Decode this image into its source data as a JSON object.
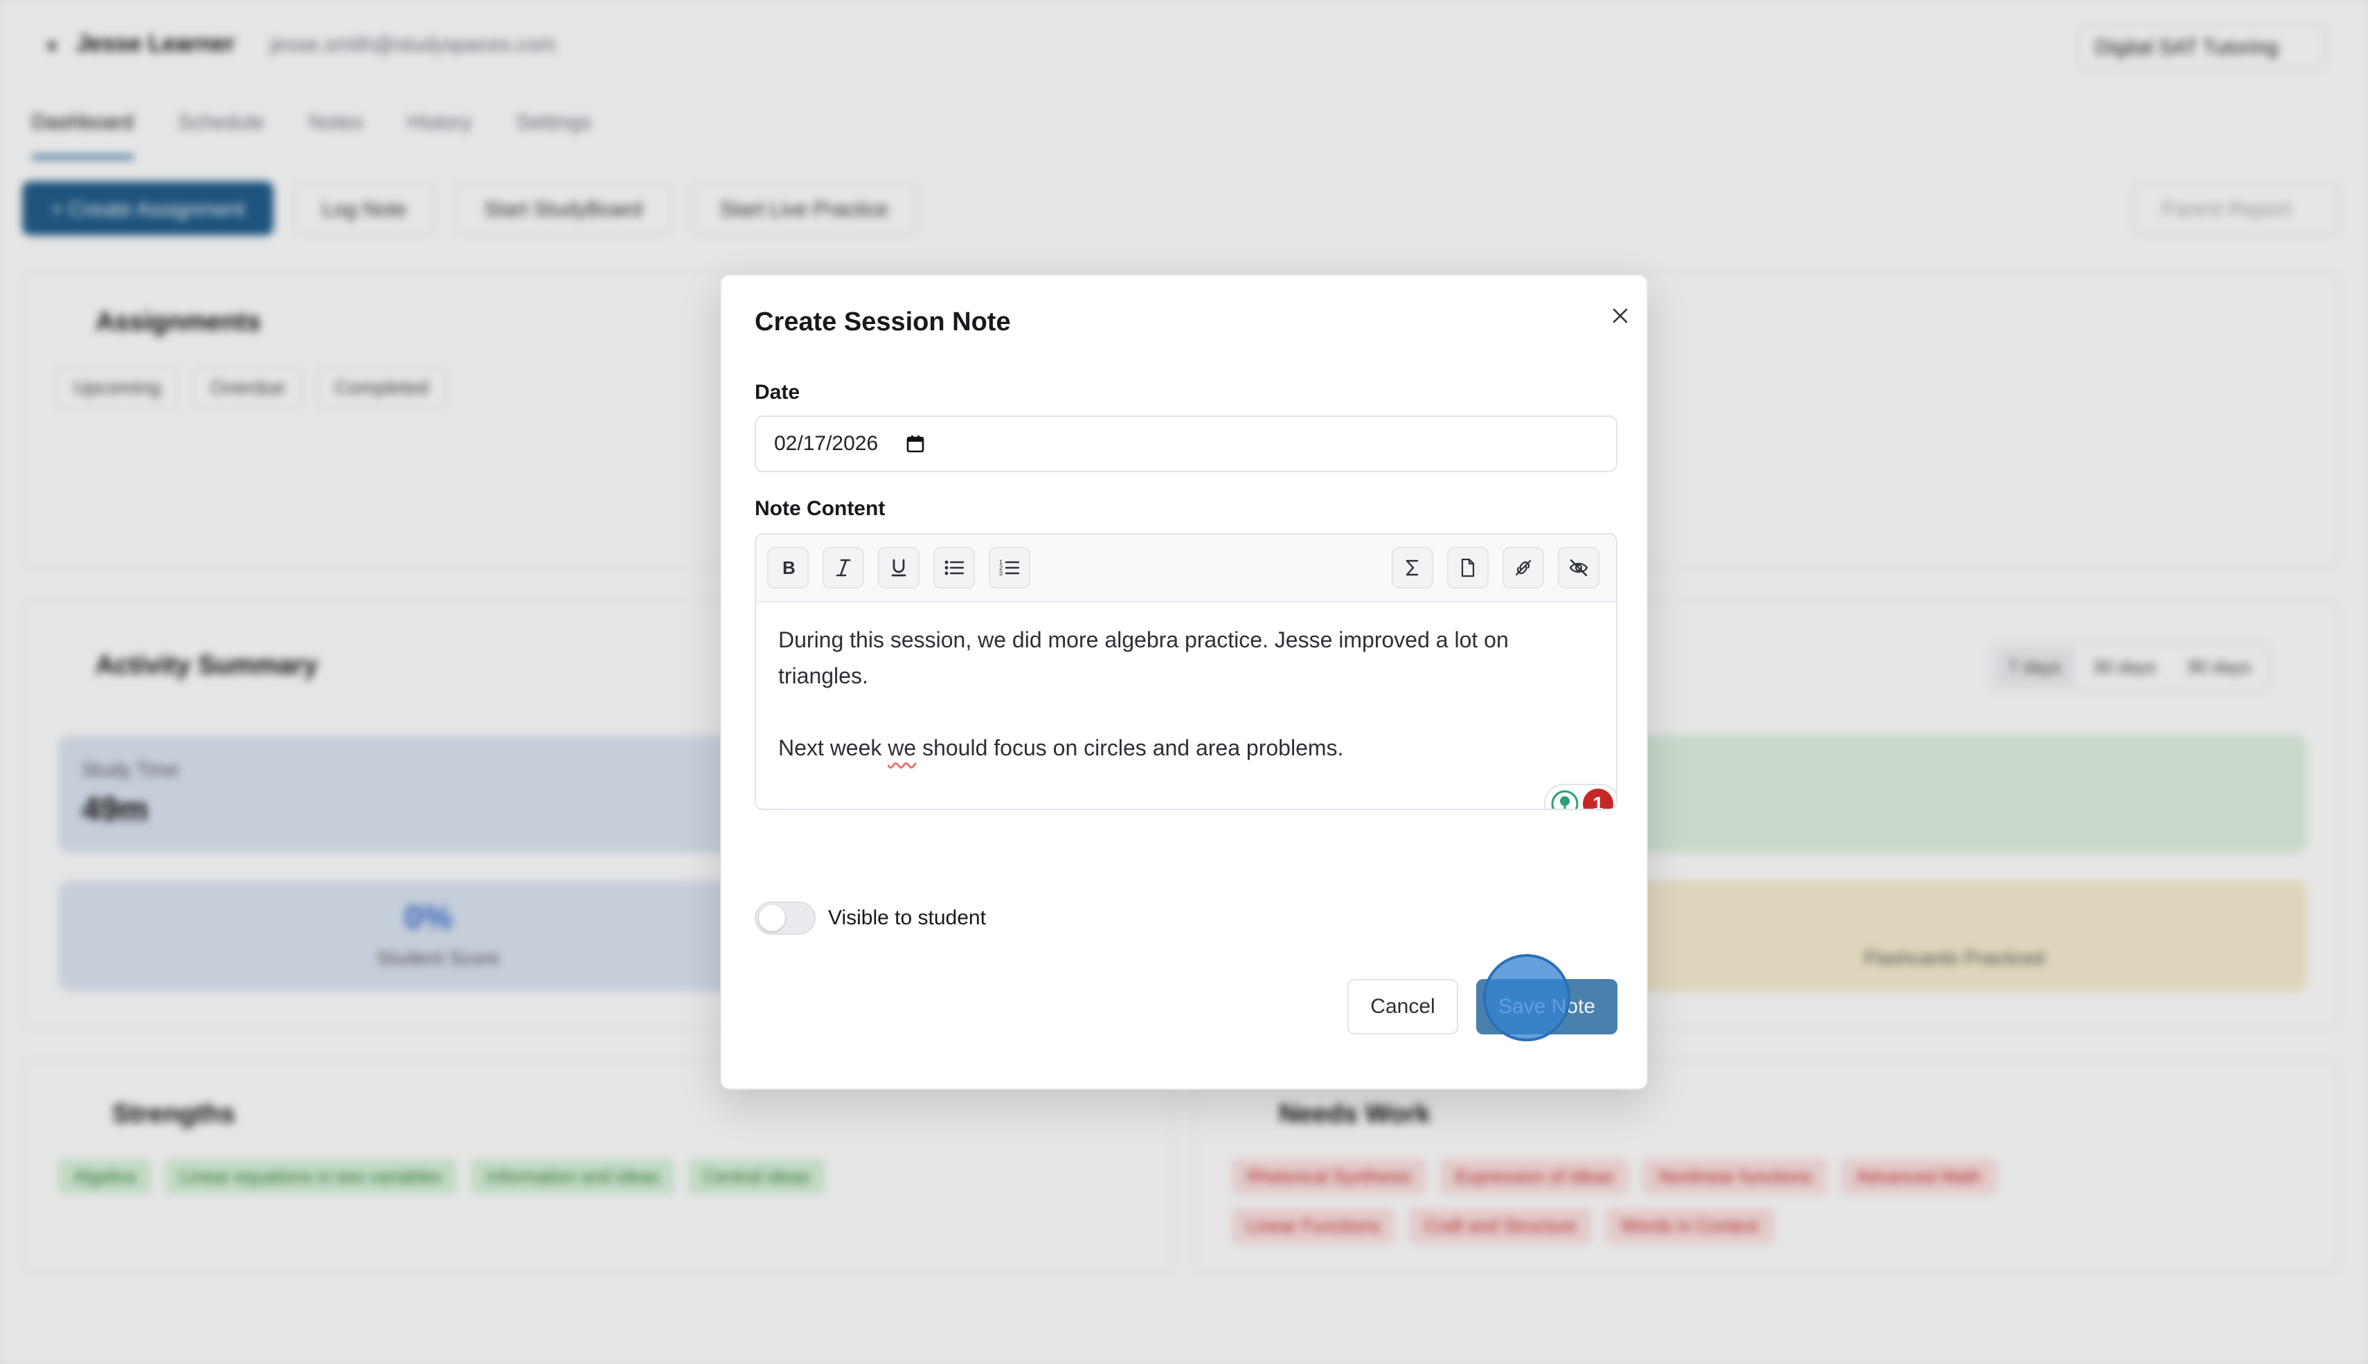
{
  "app": {
    "student_name": "Jesse Learner",
    "student_email": "jesse.smith@studyspaces.com",
    "program": "Digital SAT Tutoring",
    "tabs": [
      {
        "label": "Dashboard",
        "active": true
      },
      {
        "label": "Schedule"
      },
      {
        "label": "Notes"
      },
      {
        "label": "History"
      },
      {
        "label": "Settings"
      }
    ],
    "actions": {
      "create_assignment": "+ Create Assignment",
      "log_note": "Log Note",
      "start_studyboard": "Start StudyBoard",
      "start_live_practice": "Start Live Practice",
      "parent_report": "Parent Report"
    },
    "assignments": {
      "title": "Assignments",
      "pills": [
        "Upcoming",
        "Overdue",
        "Completed"
      ]
    },
    "activity": {
      "title": "Activity Summary",
      "ranges": [
        "7 days",
        "30 days",
        "90 days"
      ],
      "study_time_label": "Study Time",
      "study_time_value": "49m",
      "student_score_label": "Student Score",
      "student_score_value": "0%",
      "flashcards_label": "Flashcards Practiced"
    },
    "strengths": {
      "title": "Strengths",
      "tags": [
        "Algebra",
        "Linear equations in two variables",
        "Information and ideas",
        "Central ideas"
      ]
    },
    "needs_work": {
      "title": "Needs Work",
      "tags": [
        "Rhetorical Synthesis",
        "Expression of Ideas",
        "Nonlinear functions",
        "Advanced Math",
        "Linear Functions",
        "Craft and Structure",
        "Words in Context"
      ]
    }
  },
  "modal": {
    "title": "Create Session Note",
    "date_label": "Date",
    "date_value": "02/17/2026",
    "content_label": "Note Content",
    "toolbar": [
      "bold-icon",
      "italic-icon",
      "underline-icon",
      "bulleted-list-icon",
      "numbered-list-icon",
      "sigma-icon",
      "document-icon",
      "link-off-icon",
      "eye-off-icon"
    ],
    "paragraph_1": "During this session, we did more algebra practice. Jesse improved a lot on triangles.",
    "paragraph_2_before": "Next week ",
    "paragraph_2_flagged": "we",
    "paragraph_2_after": " should focus on circles and area problems.",
    "grammar_count": "1",
    "visible_label": "Visible to student",
    "visible_on": false,
    "cancel_label": "Cancel",
    "save_label": "Save Note"
  },
  "colors": {
    "primary": "#215d8b",
    "save_button": "#4a80ad",
    "grammar_badge": "#c62828",
    "cursor": "#3482d2"
  }
}
